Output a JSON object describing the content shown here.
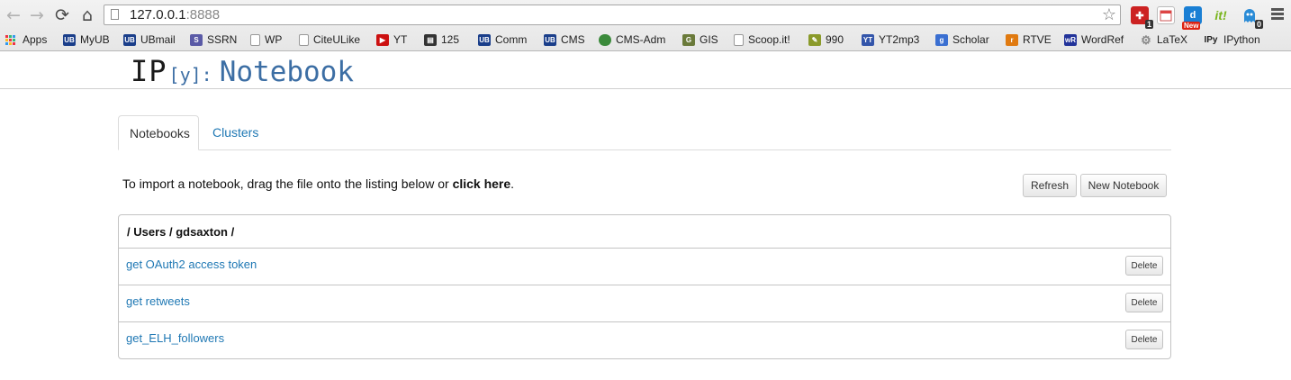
{
  "browser": {
    "url_host": "127.0.0.1",
    "url_port": ":8888",
    "extensions": [
      {
        "name": "extension-1",
        "badge": "1"
      },
      {
        "name": "extension-calendar"
      },
      {
        "name": "extension-d",
        "badge": "New"
      },
      {
        "name": "extension-it",
        "label": "it!"
      },
      {
        "name": "extension-ghostery",
        "badge": "0"
      }
    ],
    "bookmarks": [
      {
        "label": "Apps",
        "icon": "apps-grid-icon"
      },
      {
        "label": "MyUB",
        "icon": "ub-icon",
        "color": "#1a3e8a"
      },
      {
        "label": "UBmail",
        "icon": "ub-icon",
        "color": "#1a3e8a"
      },
      {
        "label": "SSRN",
        "icon": "ssrn-icon",
        "color": "#5a5aa6"
      },
      {
        "label": "WP",
        "icon": "page-icon"
      },
      {
        "label": "CiteULike",
        "icon": "page-icon"
      },
      {
        "label": "YT",
        "icon": "youtube-icon",
        "color": "#cc1111"
      },
      {
        "label": "125",
        "icon": "film-icon",
        "color": "#333333"
      },
      {
        "label": "Comm",
        "icon": "ub-icon",
        "color": "#1a3e8a"
      },
      {
        "label": "CMS",
        "icon": "ub-icon",
        "color": "#1a3e8a"
      },
      {
        "label": "CMS-Adm",
        "icon": "globe-icon",
        "color": "#3b8a3b"
      },
      {
        "label": "GIS",
        "icon": "gis-icon",
        "color": "#6a7a3a"
      },
      {
        "label": "Scoop.it!",
        "icon": "page-icon"
      },
      {
        "label": "990",
        "icon": "pen-icon",
        "color": "#8a9a2a"
      },
      {
        "label": "YT2mp3",
        "icon": "yt2mp3-icon",
        "color": "#3355aa"
      },
      {
        "label": "Scholar",
        "icon": "scholar-icon",
        "color": "#3a6fd1"
      },
      {
        "label": "RTVE",
        "icon": "rtve-icon",
        "color": "#e07a10"
      },
      {
        "label": "WordRef",
        "icon": "wordref-icon",
        "color": "#22339a"
      },
      {
        "label": "LaTeX",
        "icon": "gear-icon",
        "color": "#888888"
      },
      {
        "label": "IPython",
        "icon": "ipy-icon",
        "color": "#222222"
      }
    ]
  },
  "app": {
    "logo_ip": "IP",
    "logo_y": "[y]",
    "logo_colon": ":",
    "logo_title": "Notebook"
  },
  "tabs": [
    {
      "label": "Notebooks",
      "active": true
    },
    {
      "label": "Clusters",
      "active": false
    }
  ],
  "import": {
    "text": "To import a notebook, drag the file onto the listing below or ",
    "link": "click here",
    "end": "."
  },
  "buttons": {
    "refresh": "Refresh",
    "new_notebook": "New Notebook"
  },
  "listing": {
    "path": "/ Users / gdsaxton /",
    "notebooks": [
      {
        "name": "get OAuth2 access token",
        "delete_label": "Delete"
      },
      {
        "name": "get retweets",
        "delete_label": "Delete"
      },
      {
        "name": "get_ELH_followers",
        "delete_label": "Delete"
      }
    ]
  },
  "colors": {
    "link": "#1f78b4",
    "logo_blue": "#3c6ea4"
  }
}
